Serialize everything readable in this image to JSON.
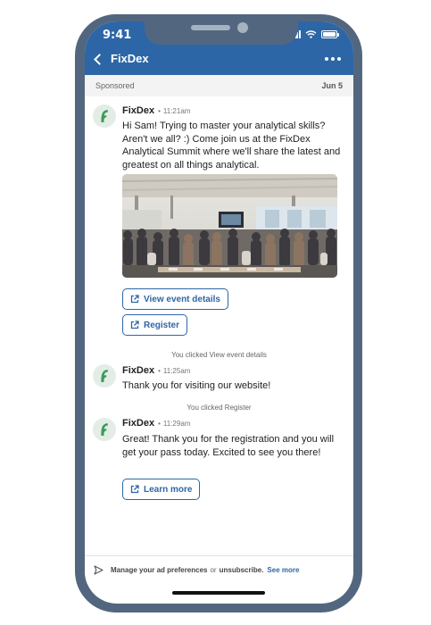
{
  "status_bar": {
    "time": "9:41"
  },
  "header": {
    "title": "FixDex"
  },
  "banner": {
    "label": "Sponsored",
    "date": "Jun 5"
  },
  "messages": [
    {
      "sender": "FixDex",
      "separator": "•",
      "time": "11:21am",
      "text": "Hi Sam! Trying to master your analytical skills? Aren't we all? :) Come join us at the FixDex Analytical Summit where we'll share the latest and greatest on all things analytical."
    },
    {
      "sender": "FixDex",
      "separator": "•",
      "time": "11:25am",
      "text": "Thank you for visiting our website!"
    },
    {
      "sender": "FixDex",
      "separator": "•",
      "time": "11:29am",
      "text": "Great! Thank you for the registration and you will get your pass today. Excited to see you there!"
    }
  ],
  "buttons": {
    "view_event": "View event details",
    "register": "Register",
    "learn_more": "Learn more"
  },
  "system_notes": {
    "clicked_view": "You clicked View event details",
    "clicked_register": "You clicked Register"
  },
  "footer": {
    "manage": "Manage your ad preferences",
    "or": "or",
    "unsubscribe": "unsubscribe.",
    "see_more": "See more"
  },
  "colors": {
    "brand_blue": "#2d66a6",
    "phone_frame": "#52677f",
    "avatar_green": "#3c9b5a"
  },
  "icons": {
    "back": "chevron-left-icon",
    "more": "more-horizontal-icon",
    "external_link": "external-link-icon",
    "send": "send-icon",
    "avatar_logo": "fixdex-leaf-logo"
  }
}
